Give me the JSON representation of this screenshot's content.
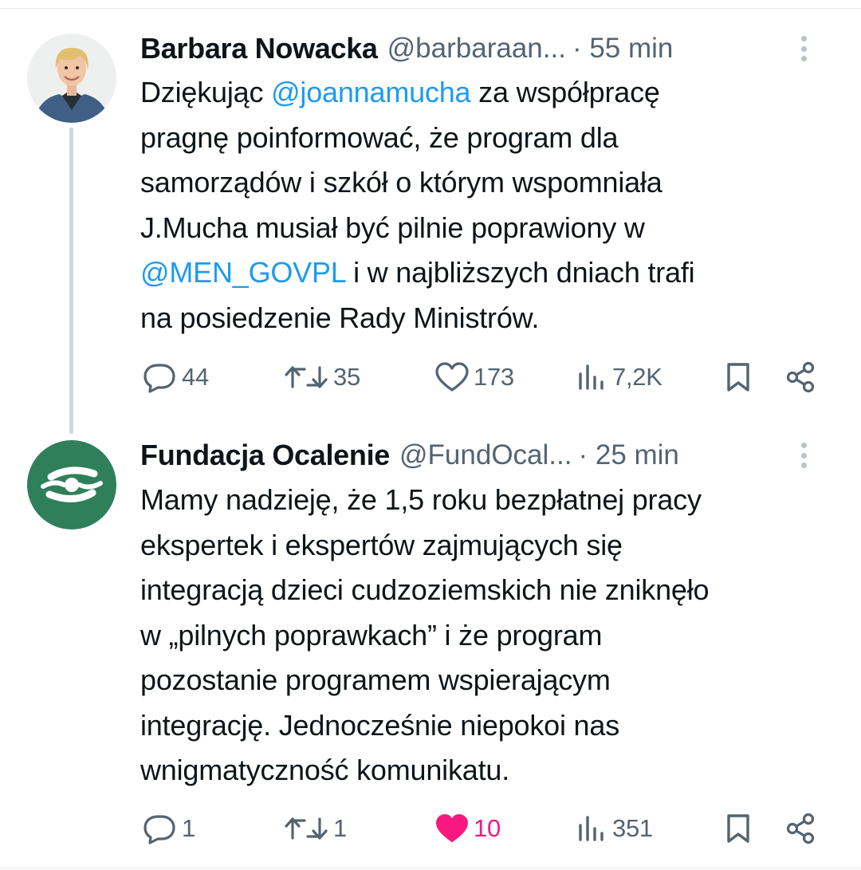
{
  "tweets": [
    {
      "name": "Barbara Nowacka",
      "handle": "@barbaraan...",
      "time": "· 55 min",
      "lines": [
        [
          {
            "t": "Dziękując "
          },
          {
            "t": "@joannamucha",
            "mention": true
          },
          {
            "t": " za współpracę"
          }
        ],
        [
          {
            "t": "pragnę poinformować, że program dla"
          }
        ],
        [
          {
            "t": "samorządów i szkół o którym wspomniała"
          }
        ],
        [
          {
            "t": "J.Mucha musiał być pilnie poprawiony w"
          }
        ],
        [
          {
            "t": "@MEN_GOVPL",
            "mention": true
          },
          {
            "t": " i w najbliższych dniach trafi"
          }
        ],
        [
          {
            "t": "na posiedzenie Rady Ministrów."
          }
        ]
      ],
      "stats": {
        "replies": "44",
        "retweets": "35",
        "likes": "173",
        "views": "7,2K"
      }
    },
    {
      "name": "Fundacja Ocalenie",
      "handle": "@FundOcal...",
      "time": "· 25 min",
      "lines": [
        [
          {
            "t": "Mamy nadzieję, że 1,5 roku bezpłatnej pracy"
          }
        ],
        [
          {
            "t": "ekspertek i ekspertów zajmujących się"
          }
        ],
        [
          {
            "t": "integracją dzieci cudzoziemskich nie zniknęło"
          }
        ],
        [
          {
            "t": "w „pilnych poprawkach” i że program"
          }
        ],
        [
          {
            "t": "pozostanie programem wspierającym"
          }
        ],
        [
          {
            "t": "integrację. Jednocześnie niepokoi nas"
          }
        ],
        [
          {
            "t": "wnigmatyczność komunikatu."
          }
        ]
      ],
      "stats": {
        "replies": "1",
        "retweets": "1",
        "likes": "10",
        "views": "351"
      }
    }
  ],
  "icons": {
    "reply": "reply-icon",
    "retweet": "retweet-icon",
    "like": "heart-icon",
    "views": "views-icon",
    "bookmark": "bookmark-icon",
    "share": "share-icon",
    "more": "more-vertical-icon"
  },
  "colors": {
    "text": "#0f1419",
    "muted": "#536471",
    "link": "#1d9bf0",
    "like_active": "#f91880",
    "ocalenie_green": "#2f7f5b",
    "thread_line": "#cfd9de"
  }
}
